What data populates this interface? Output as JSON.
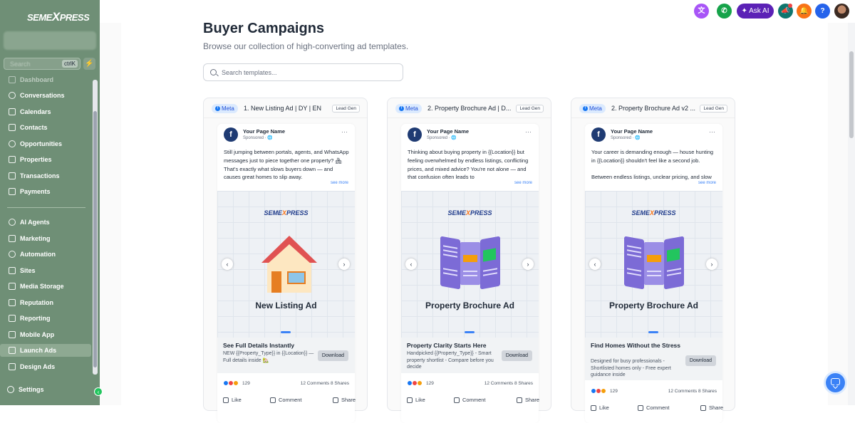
{
  "brand": {
    "name_pre": "SEME",
    "name_x": "X",
    "name_post": "PRESS"
  },
  "sidebar": {
    "search_placeholder": "Search",
    "search_shortcut": "ctrlK",
    "items": [
      {
        "label": "Dashboard",
        "icon": "dashboard-icon"
      },
      {
        "label": "Conversations",
        "icon": "chat-icon"
      },
      {
        "label": "Calendars",
        "icon": "calendar-icon"
      },
      {
        "label": "Contacts",
        "icon": "contacts-icon"
      },
      {
        "label": "Opportunities",
        "icon": "opportunities-icon"
      },
      {
        "label": "Properties",
        "icon": "properties-icon"
      },
      {
        "label": "Transactions",
        "icon": "transactions-icon"
      },
      {
        "label": "Payments",
        "icon": "payments-icon"
      },
      {
        "label": "AI Agents",
        "icon": "sparkle-icon"
      },
      {
        "label": "Marketing",
        "icon": "send-icon"
      },
      {
        "label": "Automation",
        "icon": "automation-icon"
      },
      {
        "label": "Sites",
        "icon": "sites-icon"
      },
      {
        "label": "Media Storage",
        "icon": "media-icon"
      },
      {
        "label": "Reputation",
        "icon": "reputation-icon"
      },
      {
        "label": "Reporting",
        "icon": "reporting-icon"
      },
      {
        "label": "Mobile App",
        "icon": "mobile-icon"
      },
      {
        "label": "Launch Ads",
        "icon": "launch-icon"
      },
      {
        "label": "Design Ads",
        "icon": "design-icon"
      }
    ],
    "settings": "Settings",
    "active_item": "Launch Ads"
  },
  "topbar": {
    "ask_ai": "Ask AI"
  },
  "page": {
    "title": "Buyer Campaigns",
    "subtitle": "Browse our collection of high-converting ad templates.",
    "search_placeholder": "Search templates..."
  },
  "cards": [
    {
      "platform": "Meta",
      "title": "1. New Listing Ad | DY | EN",
      "tag": "Lead Gen",
      "page_name": "Your Page Name",
      "sponsored": "Sponsored · ",
      "text": "Still jumping between portals, agents, and WhatsApp messages just to piece together one property? 🏘 That's exactly what slows buyers down — and causes great homes to slip away.",
      "see_more": "see more",
      "creative_headline": "New Listing Ad",
      "cta_headline": "See Full Details Instantly",
      "cta_sub": "NEW {{Property_Type}} in {{Location}} — Full details inside 🏡",
      "download": "Download",
      "reactions": "129",
      "stats": "12 Comments 8 Shares",
      "like": "Like",
      "comment": "Comment",
      "share": "Share"
    },
    {
      "platform": "Meta",
      "title": "2. Property Brochure Ad | D...",
      "tag": "Lead Gen",
      "page_name": "Your Page Name",
      "sponsored": "Sponsored · ",
      "text": "Thinking about buying property in {{Location}} but feeling overwhelmed by endless listings, conflicting prices, and mixed advice? You're not alone — and that confusion often leads to",
      "see_more": "see more",
      "creative_headline": "Property Brochure Ad",
      "cta_headline": "Property Clarity Starts Here",
      "cta_sub": "Handpicked {{Property_Type}} - Smart property shortlist - Compare before you decide",
      "download": "Download",
      "reactions": "129",
      "stats": "12 Comments 8 Shares",
      "like": "Like",
      "comment": "Comment",
      "share": "Share"
    },
    {
      "platform": "Meta",
      "title": "2. Property Brochure Ad v2 ...",
      "tag": "Lead Gen",
      "page_name": "Your Page Name",
      "sponsored": "Sponsored · ",
      "text": "Your career is demanding enough — house hunting in {{Location}} shouldn't feel like a second job.\n\nBetween endless listings, unclear pricing, and slow",
      "see_more": "see more",
      "creative_headline": "Property Brochure Ad",
      "cta_headline": "Find Homes Without the Stress",
      "cta_sub": "Designed for busy professionals - Shortlisted homes only - Free expert guidance inside",
      "download": "Download",
      "reactions": "129",
      "stats": "12 Comments 8 Shares",
      "like": "Like",
      "comment": "Comment",
      "share": "Share"
    }
  ]
}
